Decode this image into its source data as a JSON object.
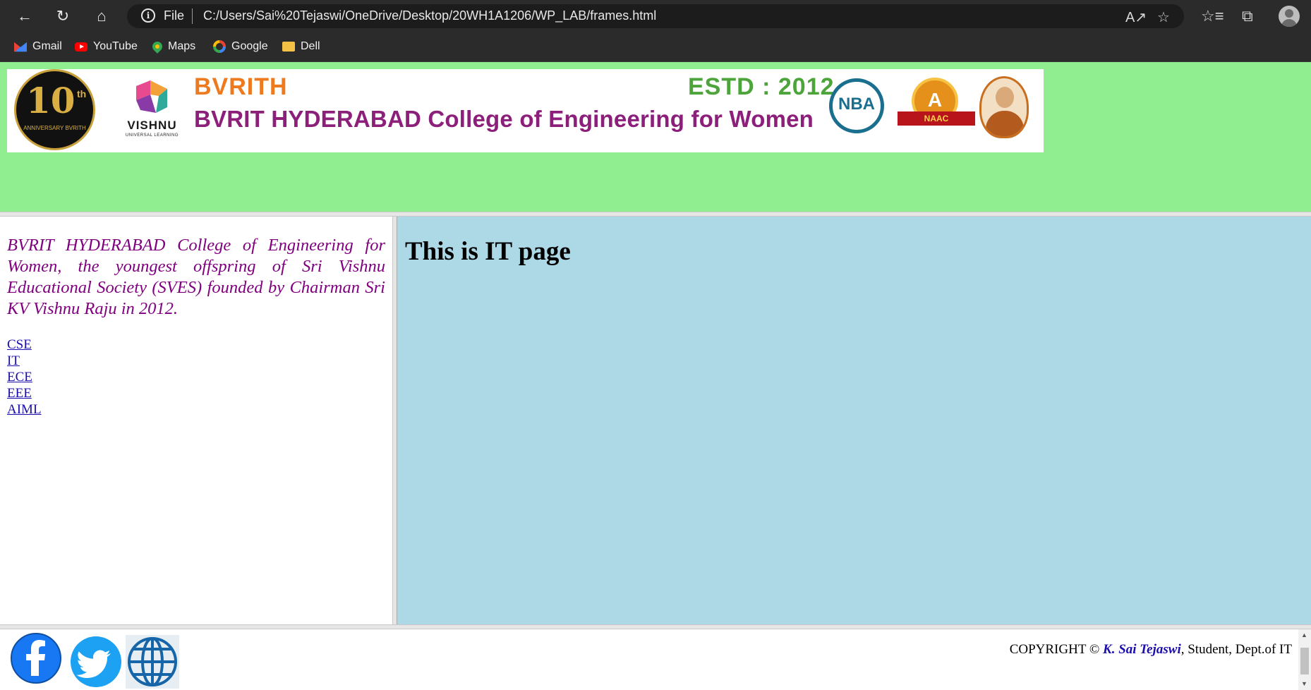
{
  "browser": {
    "protocol_label": "File",
    "url": "C:/Users/Sai%20Tejaswi/OneDrive/Desktop/20WH1A1206/WP_LAB/frames.html",
    "nav_icons": [
      "back-arrow-icon",
      "refresh-icon",
      "home-icon"
    ],
    "right_icons": [
      "read-aloud-icon",
      "add-favorite-icon",
      "favorites-icon",
      "collections-icon",
      "profile-icon"
    ],
    "bookmarks": [
      {
        "label": "Gmail",
        "icon": "gmail-icon"
      },
      {
        "label": "YouTube",
        "icon": "youtube-icon"
      },
      {
        "label": "Maps",
        "icon": "maps-icon"
      },
      {
        "label": "Google",
        "icon": "google-icon"
      },
      {
        "label": "Dell",
        "icon": "folder-icon"
      }
    ]
  },
  "header": {
    "banner": {
      "anniversary_number": "10",
      "anniversary_suffix": "th",
      "anniversary_caption": "ANNIVERSARY BVRITH",
      "vishnu_word": "VISHNU",
      "vishnu_tagline": "UNIVERSAL LEARNING",
      "short_name": "BVRITH",
      "established": "ESTD : 2012",
      "college_name": "BVRIT HYDERABAD College of Engineering for Women",
      "nba_label": "NBA",
      "naac_grade": "A",
      "naac_label": "NAAC"
    },
    "background_color": "#90ee90"
  },
  "sidebar": {
    "intro": "BVRIT HYDERABAD College of Engineering for Women, the youngest offspring of Sri Vishnu Educational Society (SVES) founded by Chairman Sri KV Vishnu Raju in 2012.",
    "links": [
      "CSE",
      "IT",
      "ECE",
      "EEE",
      "AIML"
    ]
  },
  "content": {
    "heading": "This is IT page",
    "background_color": "#add8e6"
  },
  "footer": {
    "social_icons": [
      "facebook-icon",
      "twitter-icon",
      "globe-icon"
    ],
    "copyright_prefix": "COPYRIGHT ©",
    "author": "K. Sai Tejaswi",
    "copyright_suffix": ", Student, Dept.of IT"
  }
}
